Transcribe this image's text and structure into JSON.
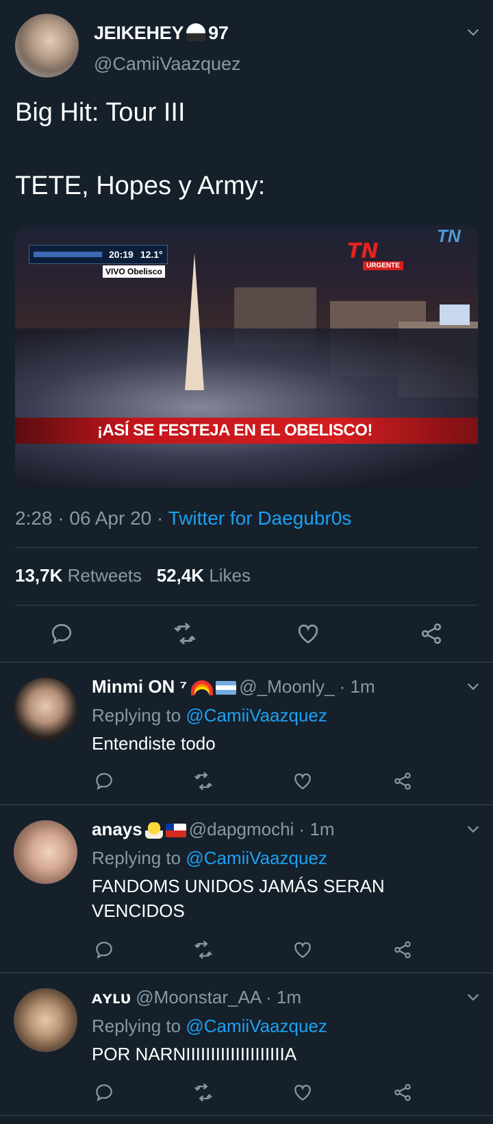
{
  "tweet": {
    "display_name": "JEIKEHEY",
    "name_suffix": "97",
    "handle": "@CamiiVaazquez",
    "text_line1": "Big Hit: Tour III",
    "text_line2": "TETE, Hopes y Army:",
    "media": {
      "osd_time": "20:19",
      "osd_temp": "12.1°",
      "osd_vivo": "VIVO Obelisco",
      "logo": "TN",
      "logo_tag": "URGENTE",
      "banner": "¡ASÍ SE FESTEJA EN EL OBELISCO!"
    },
    "time": "2:28 · 06 Apr 20 · ",
    "client": "Twitter for Daegubr0s",
    "retweets_count": "13,7K",
    "retweets_label": "Retweets",
    "likes_count": "52,4K",
    "likes_label": "Likes"
  },
  "replies": [
    {
      "name": "Minmi ON ⁷",
      "handle": "@_Moonly_ · 1m",
      "replying_prefix": "Replying to ",
      "replying_to": "@CamiiVaazquez",
      "text": "Entendiste todo"
    },
    {
      "name": "anays",
      "handle": "@dapgmochi · 1m",
      "replying_prefix": "Replying to ",
      "replying_to": "@CamiiVaazquez",
      "text": "FANDOMS UNIDOS JAMÁS SERAN VENCIDOS"
    },
    {
      "name": "ᴀʏʟᴜ",
      "handle": "@Moonstar_AA · 1m",
      "replying_prefix": "Replying to ",
      "replying_to": "@CamiiVaazquez",
      "text": "POR NARNIIIIIIIIIIIIIIIIIIIIA"
    }
  ],
  "icons": {
    "reply": "reply-icon",
    "retweet": "retweet-icon",
    "like": "heart-icon",
    "share": "share-icon",
    "menu": "chevron-down-icon"
  },
  "colors": {
    "background": "#15202b",
    "accent": "#1da1f2",
    "secondary_text": "#8899a6",
    "divider": "#38444d"
  }
}
